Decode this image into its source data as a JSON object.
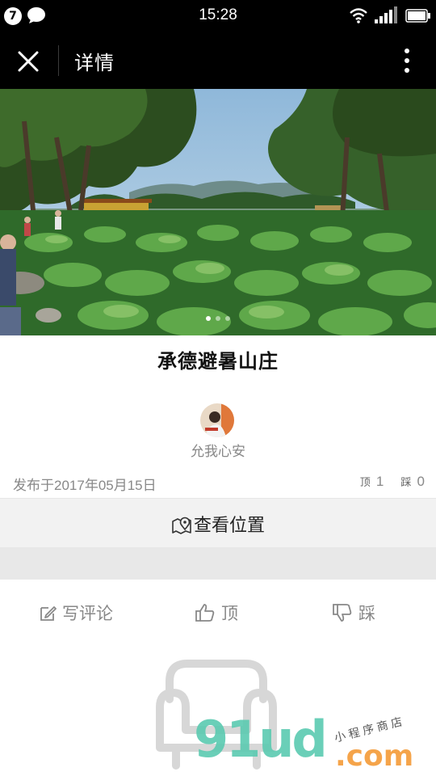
{
  "status_bar": {
    "notification_count": "7",
    "time": "15:28"
  },
  "nav": {
    "title": "详情"
  },
  "post": {
    "title": "承德避暑山庄",
    "author": "允我心安",
    "published": "发布于2017年05月15日",
    "up_icon_text": "顶",
    "up_count": "1",
    "down_icon_text": "踩",
    "down_count": "0"
  },
  "location": {
    "label": "查看位置"
  },
  "actions": {
    "comment_label": "写评论",
    "up_label": "顶",
    "down_label": "踩"
  },
  "watermark": {
    "brand": "91ud",
    "domain": ".com",
    "tagline": "小程序商店"
  },
  "colors": {
    "nav_bg": "#000000",
    "muted_text": "#888888",
    "location_bg": "#f2f2f2",
    "watermark_green": "#5ecbb2",
    "watermark_orange": "#f5a44a"
  }
}
